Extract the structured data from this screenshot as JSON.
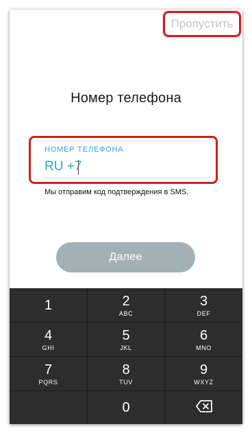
{
  "header": {
    "skip_label": "Пропустить"
  },
  "main": {
    "title": "Номер телефона",
    "phone_field": {
      "label": "НОМЕР ТЕЛЕФОНА",
      "value": "RU +7"
    },
    "hint": "Мы отправим код подтверждения в SMS.",
    "next_label": "Далее"
  },
  "keypad": {
    "keys": [
      {
        "digit": "1",
        "letters": ""
      },
      {
        "digit": "2",
        "letters": "ABC"
      },
      {
        "digit": "3",
        "letters": "DEF"
      },
      {
        "digit": "4",
        "letters": "GHI"
      },
      {
        "digit": "5",
        "letters": "JKL"
      },
      {
        "digit": "6",
        "letters": "MNO"
      },
      {
        "digit": "7",
        "letters": "PQRS"
      },
      {
        "digit": "8",
        "letters": "TUV"
      },
      {
        "digit": "9",
        "letters": "WXYZ"
      },
      {
        "digit": "0",
        "letters": ""
      }
    ],
    "delete_icon": "backspace-icon"
  },
  "colors": {
    "highlight": "#cc1f24",
    "accent": "#2fa4d9",
    "button_disabled": "#a4b0b8",
    "keypad_bg": "#2d2d2d"
  }
}
